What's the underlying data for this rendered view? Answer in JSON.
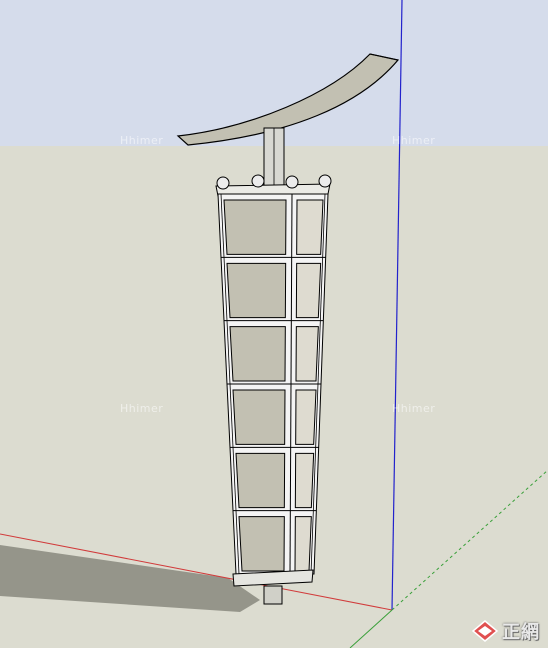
{
  "viewport": {
    "sky_color": "#d5dceb",
    "ground_color": "#dcdcd0",
    "shadow_color": "#95958a",
    "axis_colors": {
      "red": "#d13b3b",
      "green": "#3aa03a",
      "blue": "#2222cc"
    }
  },
  "model": {
    "face_color": "#c2c0b2",
    "frame_color": "#f4f4f4",
    "edge_color": "#000000",
    "panel_rows": 6
  },
  "watermarks": {
    "text": "Hhimer"
  },
  "brand": {
    "logo_icon": "diamond-logo-icon",
    "label": "正網"
  }
}
